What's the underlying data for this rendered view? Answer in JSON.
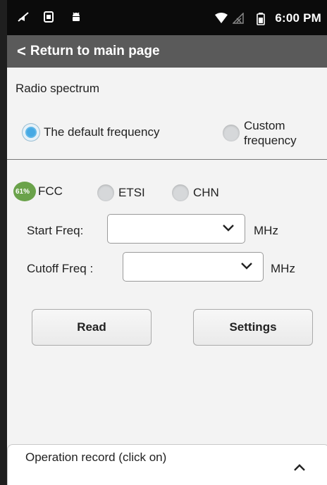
{
  "status_bar": {
    "icons_left": [
      "sound-off-icon",
      "sim-card-icon",
      "android-icon"
    ],
    "icons_right": [
      "wifi-icon",
      "no-signal-icon",
      "battery-icon"
    ],
    "time": "6:00 PM"
  },
  "toolbar": {
    "back_glyph": "<",
    "title": "Return to main page"
  },
  "spectrum": {
    "title": "Radio spectrum",
    "mode_default": "The default frequency",
    "mode_custom_line1": "Custom",
    "mode_custom_line2": "frequency",
    "selected_mode": "The default frequency"
  },
  "badge": {
    "text": "61%"
  },
  "region": {
    "options": [
      "FCC",
      "ETSI",
      "CHN"
    ],
    "selected": "FCC"
  },
  "start_freq": {
    "label": "Start Freq:",
    "value": "",
    "unit": "MHz"
  },
  "cutoff_freq": {
    "label": "Cutoff Freq :",
    "value": "",
    "unit": "MHz"
  },
  "actions": {
    "read_label": "Read",
    "settings_label": "Settings"
  },
  "record_panel": {
    "label": "Operation record (click on)",
    "toggle_icon": "chevron-up-icon"
  },
  "colors": {
    "status_bar_bg": "#0b0b0b",
    "toolbar_bg": "#5a5a5a",
    "radio_selected": "#46a9e4",
    "page_bg": "#f3f3f3"
  }
}
